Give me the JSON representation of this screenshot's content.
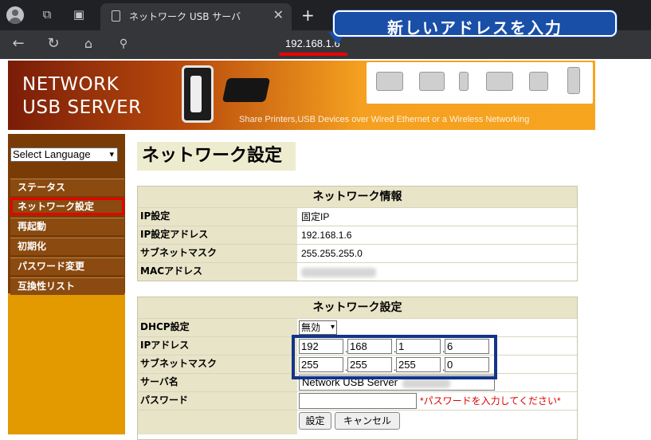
{
  "browser": {
    "tab_title": "ネットワーク USB サーバ",
    "url": "192.168.1.6"
  },
  "callout": {
    "text": "新しいアドレスを入力"
  },
  "banner": {
    "brand_line1": "NETWORK",
    "brand_line2": "USB SERVER",
    "tagline": "Share Printers,USB Devices over Wired Ethernet or a Wireless Networking"
  },
  "sidebar": {
    "language_select": "Select Language",
    "items": [
      {
        "label": "ステータス"
      },
      {
        "label": "ネットワーク設定"
      },
      {
        "label": "再起動"
      },
      {
        "label": "初期化"
      },
      {
        "label": "パスワード変更"
      },
      {
        "label": "互換性リスト"
      }
    ]
  },
  "page_title": "ネットワーク設定",
  "info_panel": {
    "title": "ネットワーク情報",
    "rows": [
      {
        "label": "IP設定",
        "value": "固定IP"
      },
      {
        "label": "IP設定アドレス",
        "value": "192.168.1.6"
      },
      {
        "label": "サブネットマスク",
        "value": "255.255.255.0"
      },
      {
        "label": "MACアドレス",
        "value": ""
      }
    ]
  },
  "settings_panel": {
    "title": "ネットワーク設定",
    "dhcp_label": "DHCP設定",
    "dhcp_value": "無効",
    "ip_label": "IPアドレス",
    "ip_octets": [
      "192",
      "168",
      "1",
      "6"
    ],
    "mask_label": "サブネットマスク",
    "mask_octets": [
      "255",
      "255",
      "255",
      "0"
    ],
    "server_label": "サーバ名",
    "server_value": "Network USB Server",
    "password_label": "パスワード",
    "password_hint": "*パスワードを入力してください*",
    "submit_label": "設定",
    "cancel_label": "キャンセル"
  },
  "colors": {
    "sidebar_bg": "#7a3c06",
    "sidebar_lower": "#e39a00",
    "highlight_red": "#e80000",
    "highlight_blue": "#12358a",
    "callout_bg": "#1a4fa8"
  }
}
